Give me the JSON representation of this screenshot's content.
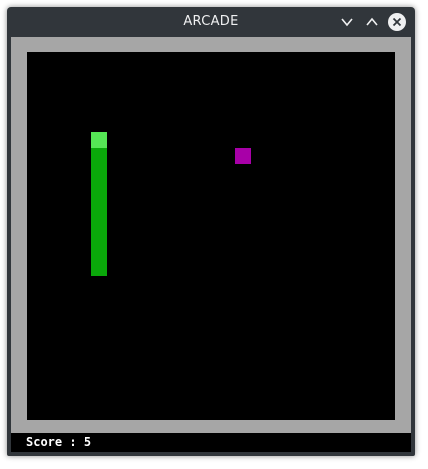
{
  "window": {
    "title": "ARCADE"
  },
  "titlebar_buttons": [
    {
      "name": "minimize",
      "icon": "chevron-down-icon"
    },
    {
      "name": "maximize",
      "icon": "chevron-up-icon"
    },
    {
      "name": "close",
      "icon": "close-icon"
    }
  ],
  "game": {
    "grid_cols": 23,
    "grid_rows": 23,
    "snake": {
      "head": [
        4,
        5
      ],
      "body": [
        [
          4,
          6
        ],
        [
          4,
          7
        ],
        [
          4,
          8
        ],
        [
          4,
          9
        ],
        [
          4,
          10
        ],
        [
          4,
          11
        ],
        [
          4,
          12
        ],
        [
          4,
          13
        ]
      ]
    },
    "food": [
      13,
      6
    ]
  },
  "status": {
    "score_label": "Score",
    "separator": " : ",
    "score_value": "5"
  },
  "colors": {
    "titlebar": "#31363b",
    "frame_border": "#a6a6a6",
    "playfield": "#000000",
    "snake_head": "#55e755",
    "snake_body": "#0aa80a",
    "food": "#a800a8",
    "status_bar": "#000000",
    "status_text": "#ffffff"
  }
}
